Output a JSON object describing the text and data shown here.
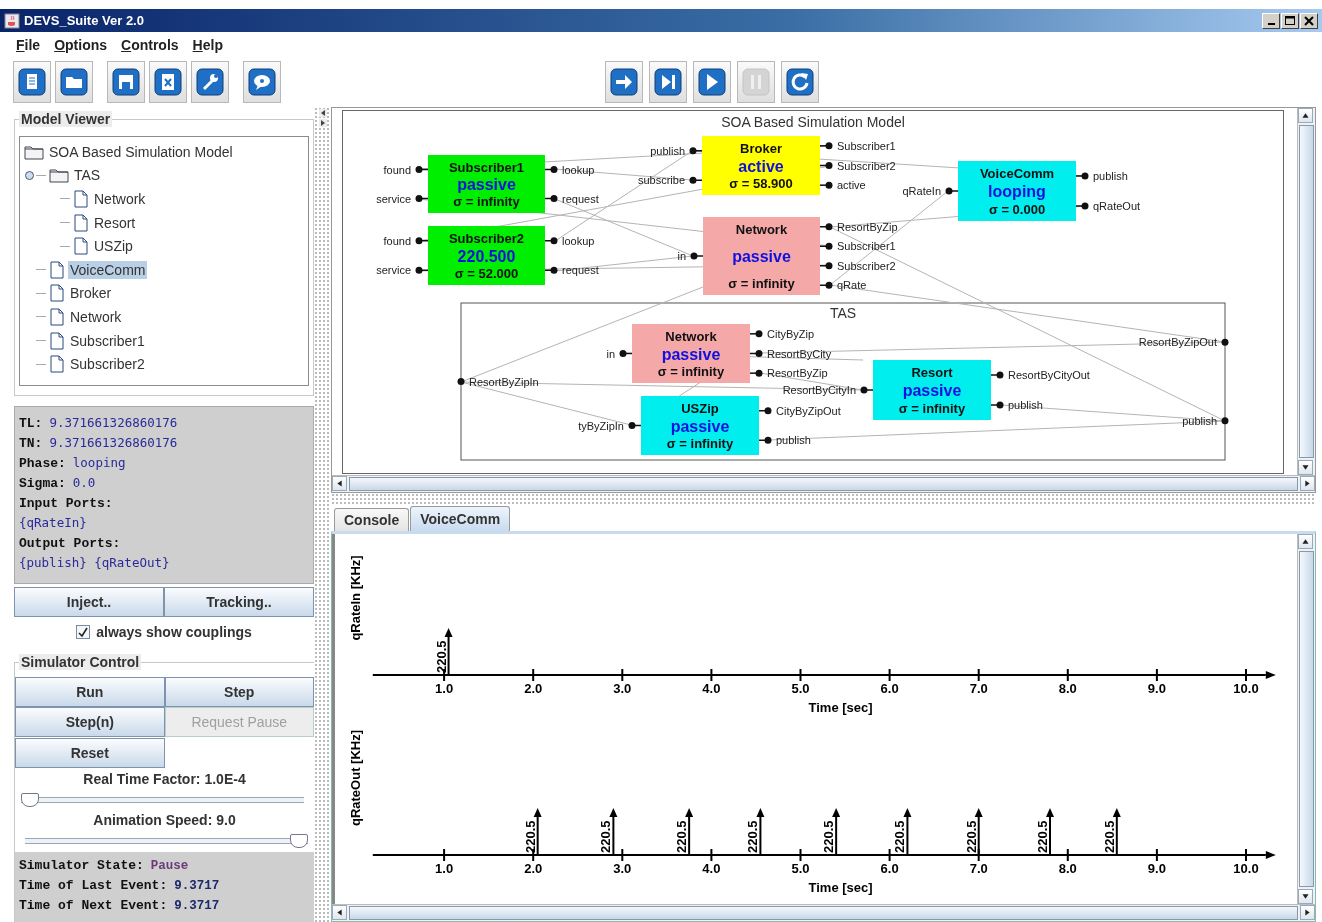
{
  "window": {
    "title": "DEVS_Suite Ver 2.0"
  },
  "menu": [
    "File",
    "Options",
    "Controls",
    "Help"
  ],
  "playback": [
    {
      "disabled": false
    },
    {
      "disabled": false
    },
    {
      "disabled": false
    },
    {
      "disabled": true
    },
    {
      "disabled": false
    }
  ],
  "model_viewer": {
    "title": "Model Viewer",
    "tree": {
      "label": "SOA Based Simulation Model",
      "selected": false,
      "children": [
        {
          "label": "TAS",
          "selected": false,
          "expanded": true,
          "children": [
            {
              "label": "Network",
              "selected": false
            },
            {
              "label": "Resort",
              "selected": false
            },
            {
              "label": "USZip",
              "selected": false
            }
          ]
        },
        {
          "label": "VoiceComm",
          "selected": true
        },
        {
          "label": "Broker",
          "selected": false
        },
        {
          "label": "Network",
          "selected": false
        },
        {
          "label": "Subscriber1",
          "selected": false
        },
        {
          "label": "Subscriber2",
          "selected": false
        }
      ]
    }
  },
  "info": [
    {
      "label": "TL:",
      "value": "9.371661326860176"
    },
    {
      "label": "TN:",
      "value": "9.371661326860176"
    },
    {
      "label": "Phase:",
      "value": "looping"
    },
    {
      "label": "Sigma:",
      "value": "0.0"
    },
    {
      "label": "Input Ports:"
    },
    {
      "value": "{qRateIn}"
    },
    {
      "label": "Output Ports:"
    },
    {
      "value": "{publish} {qRateOut}"
    }
  ],
  "model_buttons": [
    "Inject..",
    "Tracking.."
  ],
  "couplings_checkbox": {
    "label": "always show couplings",
    "checked": true
  },
  "simulator_control": {
    "title": "Simulator Control",
    "buttons": [
      {
        "label": "Run",
        "disabled": false
      },
      {
        "label": "Step",
        "disabled": false
      },
      {
        "label": "Step(n)",
        "disabled": false
      },
      {
        "label": "Request Pause",
        "disabled": true
      },
      {
        "label": "Reset",
        "disabled": false
      }
    ],
    "sliders": [
      {
        "label": "Real Time Factor: 1.0E-4",
        "level": 0
      },
      {
        "label": "Animation Speed: 9.0",
        "level": 1
      }
    ],
    "status": [
      {
        "label": "Simulator State:",
        "value": "Pause"
      },
      {
        "label": "Time of Last Event:",
        "value": "9.3717"
      },
      {
        "label": "Time of Next Event:",
        "value": "9.3717"
      }
    ]
  },
  "diagram": {
    "title": "SOA Based Simulation Model",
    "models": [
      {
        "name": "Subscriber1",
        "phase": "passive",
        "sigma": "σ = infinity",
        "color": "#00ee00",
        "inputs": [
          "found",
          "service"
        ],
        "outputs": [
          "lookup",
          "request"
        ]
      },
      {
        "name": "Subscriber2",
        "phase": "220.500",
        "sigma": "σ = 52.000",
        "color": "#00ee00",
        "inputs": [
          "found",
          "service"
        ],
        "outputs": [
          "lookup",
          "request"
        ]
      },
      {
        "name": "Broker",
        "phase": "active",
        "sigma": "σ = 58.900",
        "color": "#ffff00",
        "inputs": [
          "publish",
          "subscribe"
        ],
        "outputs": [
          "Subscriber1",
          "Subscriber2",
          "active"
        ]
      },
      {
        "name": "Network",
        "phase": "passive",
        "sigma": "σ = infinity",
        "color": "#f4a8a8",
        "inputs": [
          "in"
        ],
        "outputs": [
          "ResortByZip",
          "Subscriber1",
          "Subscriber2",
          "qRate"
        ]
      },
      {
        "name": "VoiceComm",
        "phase": "looping",
        "sigma": "σ = 0.000",
        "color": "#00eeee",
        "inputs": [
          "qRateIn"
        ],
        "outputs": [
          "publish",
          "qRateOut"
        ]
      }
    ],
    "coupled": {
      "name": "TAS",
      "inputs": [
        "ResortByZipIn"
      ],
      "outputs": [
        "ResortByZipOut",
        "publish"
      ],
      "models": [
        {
          "name": "Network",
          "phase": "passive",
          "sigma": "σ = infinity",
          "color": "#f4a8a8",
          "inputs": [
            "in"
          ],
          "outputs": [
            "CityByZip",
            "ResortByCity",
            "ResortByZip"
          ]
        },
        {
          "name": "USZip",
          "phase": "passive",
          "sigma": "σ = infinity",
          "color": "#00eeee",
          "inputs": [
            "tyByZipIn"
          ],
          "outputs": [
            "CityByZipOut",
            "publish"
          ]
        },
        {
          "name": "Resort",
          "phase": "passive",
          "sigma": "σ = infinity",
          "color": "#00eeee",
          "inputs": [
            "ResortByCityIn"
          ],
          "outputs": [
            "ResortByCityOut",
            "publish"
          ]
        }
      ]
    }
  },
  "tabs": [
    {
      "label": "Console",
      "selected": false
    },
    {
      "label": "VoiceComm",
      "selected": true
    }
  ],
  "plots": [
    {
      "ylabel": "qRateIn  [KHz]",
      "xlabel": "Time [sec]",
      "ticks": [
        "1.0",
        "2.0",
        "3.0",
        "4.0",
        "5.0",
        "6.0",
        "7.0",
        "8.0",
        "9.0",
        "10.0"
      ],
      "event_labels": [
        "220.5"
      ]
    },
    {
      "ylabel": "qRateOut  [KHz]",
      "xlabel": "Time [sec]",
      "ticks": [
        "1.0",
        "2.0",
        "3.0",
        "4.0",
        "5.0",
        "6.0",
        "7.0",
        "8.0",
        "9.0",
        "10.0"
      ],
      "event_labels": [
        "220.5",
        "220.5",
        "220.5",
        "220.5",
        "220.5",
        "220.5",
        "220.5",
        "220.5",
        "220.5"
      ]
    }
  ]
}
